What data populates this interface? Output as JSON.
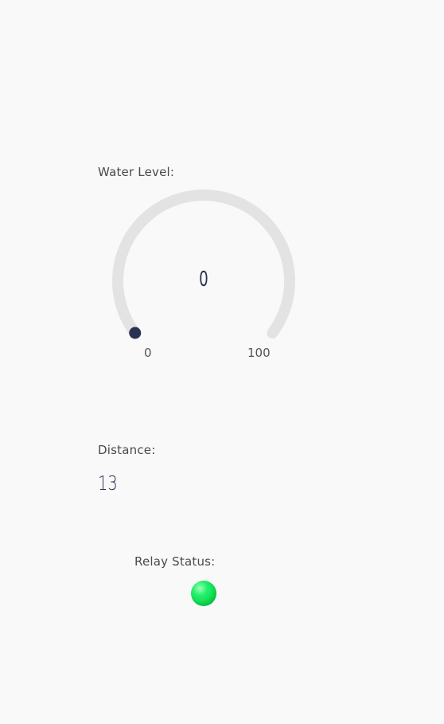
{
  "water_level": {
    "label": "Water Level:",
    "value": "0",
    "min": "0",
    "max": "100",
    "value_fraction": 0,
    "track_color": "#e3e3e3",
    "indicator_color": "#2b3150"
  },
  "distance": {
    "label": "Distance:",
    "value": "13"
  },
  "relay": {
    "label": "Relay Status:",
    "state_color": "#16e05a",
    "icon": "led-indicator-icon"
  }
}
